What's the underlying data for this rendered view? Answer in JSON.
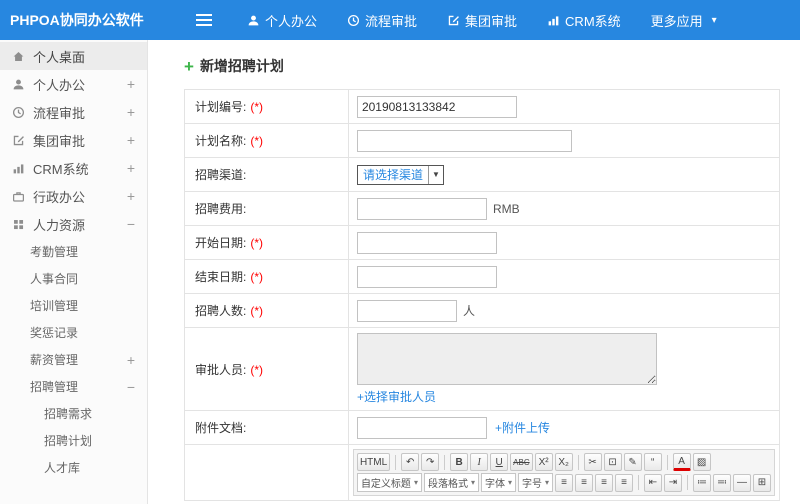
{
  "navbar": {
    "brand": "PHPOA协同办公软件",
    "items": [
      {
        "label": "个人办公",
        "name": "personal-office",
        "icon": "person"
      },
      {
        "label": "流程审批",
        "name": "process-approval",
        "icon": "clock"
      },
      {
        "label": "集团审批",
        "name": "group-approval",
        "icon": "edit"
      },
      {
        "label": "CRM系统",
        "name": "crm-system",
        "icon": "chart"
      },
      {
        "label": "更多应用",
        "name": "more-apps",
        "icon": "",
        "chevron": true
      }
    ]
  },
  "sidebar": {
    "items": [
      {
        "label": "个人桌面",
        "name": "personal-desktop",
        "icon": "home",
        "level": 1,
        "active": true
      },
      {
        "label": "个人办公",
        "name": "personal-office",
        "icon": "person",
        "level": 1,
        "toggle": "+"
      },
      {
        "label": "流程审批",
        "name": "process-approval",
        "icon": "clock",
        "level": 1,
        "toggle": "+"
      },
      {
        "label": "集团审批",
        "name": "group-approval",
        "icon": "edit",
        "level": 1,
        "toggle": "+"
      },
      {
        "label": "CRM系统",
        "name": "crm-system",
        "icon": "chart",
        "level": 1,
        "toggle": "+"
      },
      {
        "label": "行政办公",
        "name": "admin-office",
        "icon": "briefcase",
        "level": 1,
        "toggle": "+"
      },
      {
        "label": "人力资源",
        "name": "human-resources",
        "icon": "grid",
        "level": 1,
        "toggle": "−"
      },
      {
        "label": "考勤管理",
        "name": "attendance-management",
        "level": 2
      },
      {
        "label": "人事合同",
        "name": "personnel-contract",
        "level": 2
      },
      {
        "label": "培训管理",
        "name": "training-management",
        "level": 2
      },
      {
        "label": "奖惩记录",
        "name": "reward-punishment-record",
        "level": 2
      },
      {
        "label": "薪资管理",
        "name": "salary-management",
        "level": 2,
        "toggle": "+"
      },
      {
        "label": "招聘管理",
        "name": "recruitment-management",
        "level": 2,
        "toggle": "−"
      },
      {
        "label": "招聘需求",
        "name": "recruitment-demand",
        "level": 3
      },
      {
        "label": "招聘计划",
        "name": "recruitment-plan",
        "level": 3
      },
      {
        "label": "人才库",
        "name": "talent-pool",
        "level": 3
      }
    ]
  },
  "main": {
    "title": "新增招聘计划",
    "form": {
      "rows": [
        {
          "label": "计划编号:",
          "required": "(*)",
          "value": "20190813133842"
        },
        {
          "label": "计划名称:",
          "required": "(*)",
          "value": ""
        },
        {
          "label": "招聘渠道:",
          "required": "",
          "select_value": "请选择渠道"
        },
        {
          "label": "招聘费用:",
          "required": "",
          "suffix": "RMB"
        },
        {
          "label": "开始日期:",
          "required": "(*)"
        },
        {
          "label": "结束日期:",
          "required": "(*)"
        },
        {
          "label": "招聘人数:",
          "required": "(*)",
          "suffix": "人"
        },
        {
          "label": "审批人员:",
          "required": "(*)",
          "link": "+选择审批人员"
        },
        {
          "label": "附件文档:",
          "required": "",
          "link": "+附件上传"
        }
      ]
    },
    "editor": {
      "toolbar_row1": [
        {
          "t": "HTML",
          "name": "html-source-button"
        },
        {
          "t": "|"
        },
        {
          "t": "↶",
          "name": "undo-button"
        },
        {
          "t": "↷",
          "name": "redo-button"
        },
        {
          "t": "|"
        },
        {
          "t": "B",
          "name": "bold-button",
          "cls": "bb"
        },
        {
          "t": "I",
          "name": "italic-button",
          "cls": "ii"
        },
        {
          "t": "U",
          "name": "underline-button",
          "cls": "uu"
        },
        {
          "t": "ABC",
          "name": "strikethrough-button",
          "cls": "ss"
        },
        {
          "t": "X²",
          "name": "superscript-button"
        },
        {
          "t": "X₂",
          "name": "subscript-button"
        },
        {
          "t": "|"
        },
        {
          "t": "✂",
          "name": "cut-button"
        },
        {
          "t": "⊡",
          "name": "paste-button"
        },
        {
          "t": "✎",
          "name": "format-brush-button"
        },
        {
          "t": "“",
          "name": "blockquote-button"
        },
        {
          "t": "|"
        },
        {
          "t": "A",
          "name": "font-color-button",
          "cls": "fc"
        },
        {
          "t": "▨",
          "name": "highlight-button"
        }
      ],
      "toolbar_row2_dropdowns": [
        {
          "label": "自定义标题",
          "name": "custom-heading-select"
        },
        {
          "label": "段落格式",
          "name": "paragraph-format-select"
        },
        {
          "label": "字体",
          "name": "font-family-select"
        },
        {
          "label": "字号",
          "name": "font-size-select"
        }
      ],
      "toolbar_row2_icons": [
        {
          "t": "≡",
          "name": "align-left-button"
        },
        {
          "t": "≡",
          "name": "align-center-button"
        },
        {
          "t": "≡",
          "name": "align-right-button"
        },
        {
          "t": "≡",
          "name": "align-justify-button"
        },
        {
          "t": "|"
        },
        {
          "t": "⇤",
          "name": "outdent-button"
        },
        {
          "t": "⇥",
          "name": "indent-button"
        },
        {
          "t": "|"
        },
        {
          "t": "≔",
          "name": "ordered-list-button"
        },
        {
          "t": "≕",
          "name": "unordered-list-button"
        },
        {
          "t": "—",
          "name": "horizontal-rule-button"
        },
        {
          "t": "⊞",
          "name": "table-button"
        }
      ]
    }
  }
}
